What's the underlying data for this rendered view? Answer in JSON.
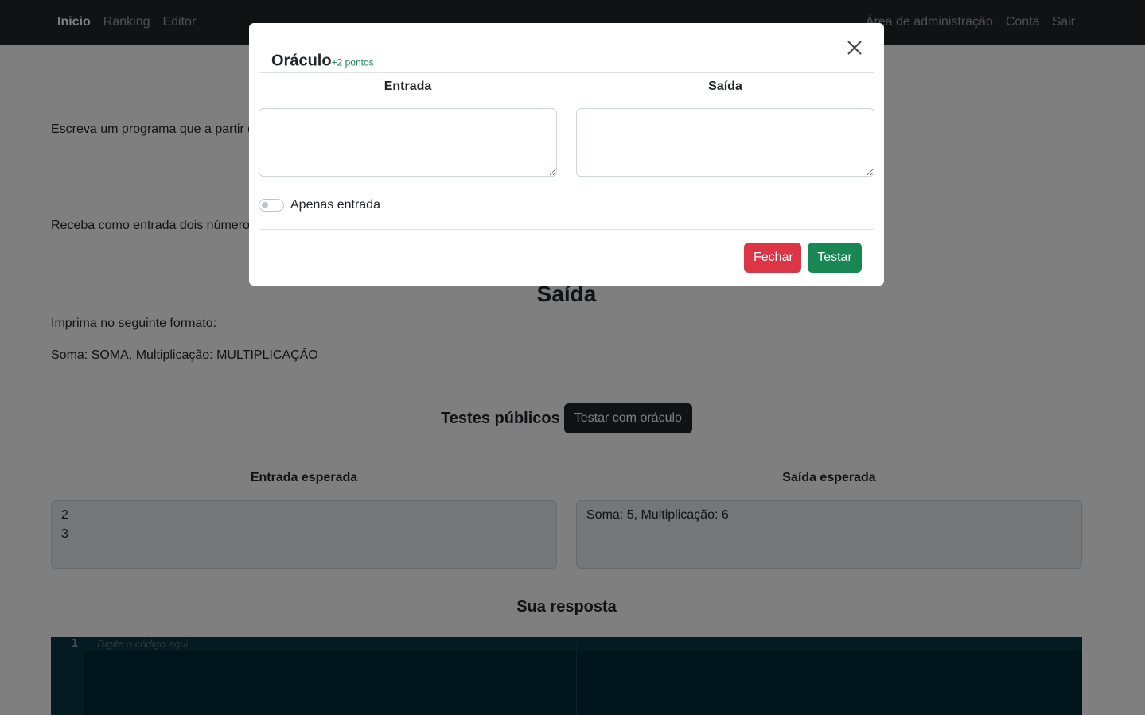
{
  "nav": {
    "left": [
      "Inicio",
      "Ranking",
      "Editor"
    ],
    "right": [
      "Área de administração",
      "Conta",
      "Sair"
    ]
  },
  "page": {
    "description_partial": "Escreva um programa que a partir d",
    "input_partial": "Receba como entrada dois números",
    "output_heading": "Saída",
    "output_format_intro": "Imprima no seguinte formato:",
    "output_format": "Soma: SOMA, Multiplicação: MULTIPLICAÇÃO",
    "public_tests_heading": "Testes públicos",
    "oracle_button": "Testar com oráculo",
    "expected_input_label": "Entrada esperada",
    "expected_output_label": "Saída esperada",
    "expected_input_value": "2\n3",
    "expected_output_value": "Soma: 5, Multiplicação: 6",
    "answer_heading": "Sua resposta",
    "editor_line_number": "1",
    "editor_placeholder": "Digite o código aqui"
  },
  "modal": {
    "title": "Oráculo",
    "points": "+2 pontos",
    "input_label": "Entrada",
    "output_label": "Saída",
    "input_value": "",
    "output_value": "",
    "toggle_label": "Apenas entrada",
    "toggle_on": false,
    "close_button": "Fechar",
    "test_button": "Testar"
  },
  "colors": {
    "navbar": "#212529",
    "danger": "#dc3545",
    "success": "#198754",
    "editor_bg": "#002b36"
  }
}
